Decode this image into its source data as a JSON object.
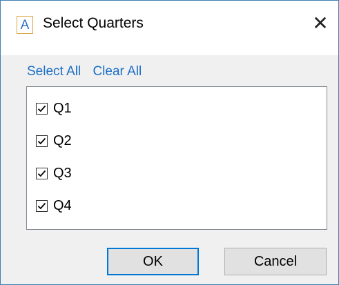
{
  "window": {
    "title": "Select Quarters",
    "app_icon_letter": "A",
    "close_glyph": "✕"
  },
  "links": {
    "select_all": "Select All",
    "clear_all": "Clear All"
  },
  "quarters": [
    {
      "label": "Q1",
      "checked": true
    },
    {
      "label": "Q2",
      "checked": true
    },
    {
      "label": "Q3",
      "checked": true
    },
    {
      "label": "Q4",
      "checked": true
    }
  ],
  "buttons": {
    "ok": "OK",
    "cancel": "Cancel"
  },
  "colors": {
    "link": "#1a6ec7",
    "default_button_border": "#0078d7",
    "window_border": "#3c7fb1"
  },
  "icons": {
    "app": "app-letter-icon",
    "close": "close-icon",
    "check": "checkmark-icon"
  }
}
